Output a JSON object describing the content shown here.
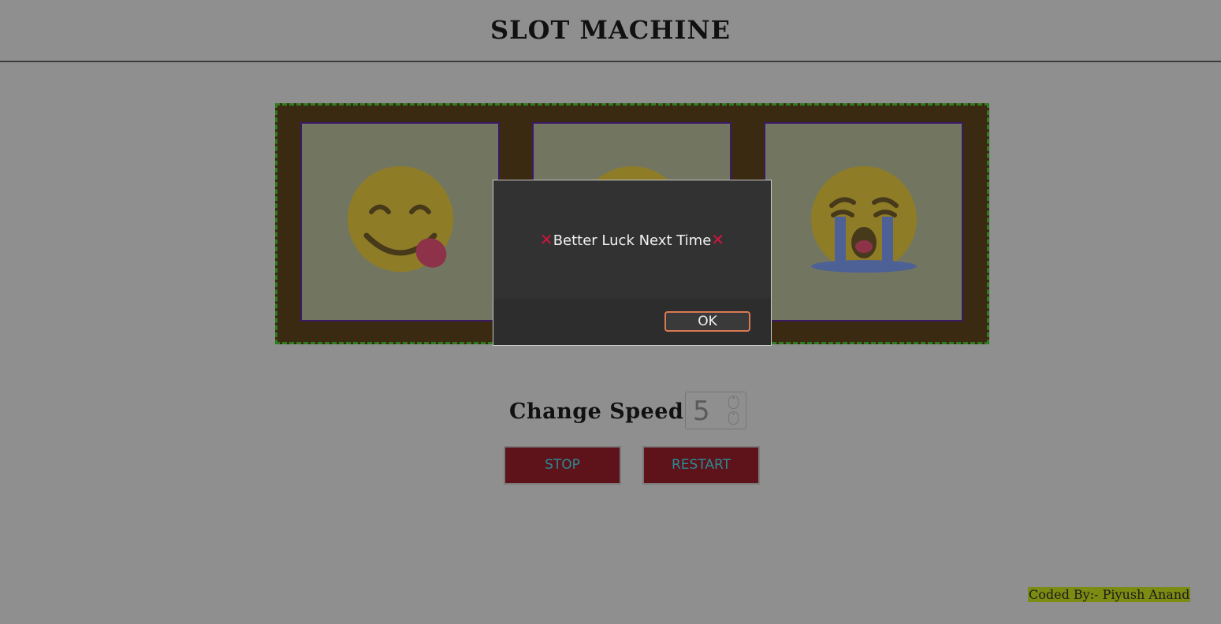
{
  "header": {
    "title": "SLOT MACHINE"
  },
  "reels": [
    {
      "emoji": "face-savoring-food-icon"
    },
    {
      "emoji": "smiling-face-icon"
    },
    {
      "emoji": "loudly-crying-face-icon"
    }
  ],
  "controls": {
    "speed_label": "Change Speed",
    "speed_value": "5",
    "stop_label": "STOP",
    "restart_label": "RESTART"
  },
  "dialog": {
    "message": "Better Luck Next Time",
    "cross_symbol": "✕",
    "ok_label": "OK"
  },
  "footer": {
    "credit": "Coded By:- Piyush Anand"
  },
  "colors": {
    "overlay_background": "#8f8f8f",
    "machine_border": "#2e7d1e",
    "machine_fill": "#3a2a12",
    "reel_fill": "#727660",
    "button_fill": "#5e131b",
    "button_text": "#2a8a94",
    "dialog_background": "#323232",
    "dialog_cross": "#d3143c",
    "ok_border": "#d97a52",
    "credit_highlight": "#7c8c12"
  }
}
